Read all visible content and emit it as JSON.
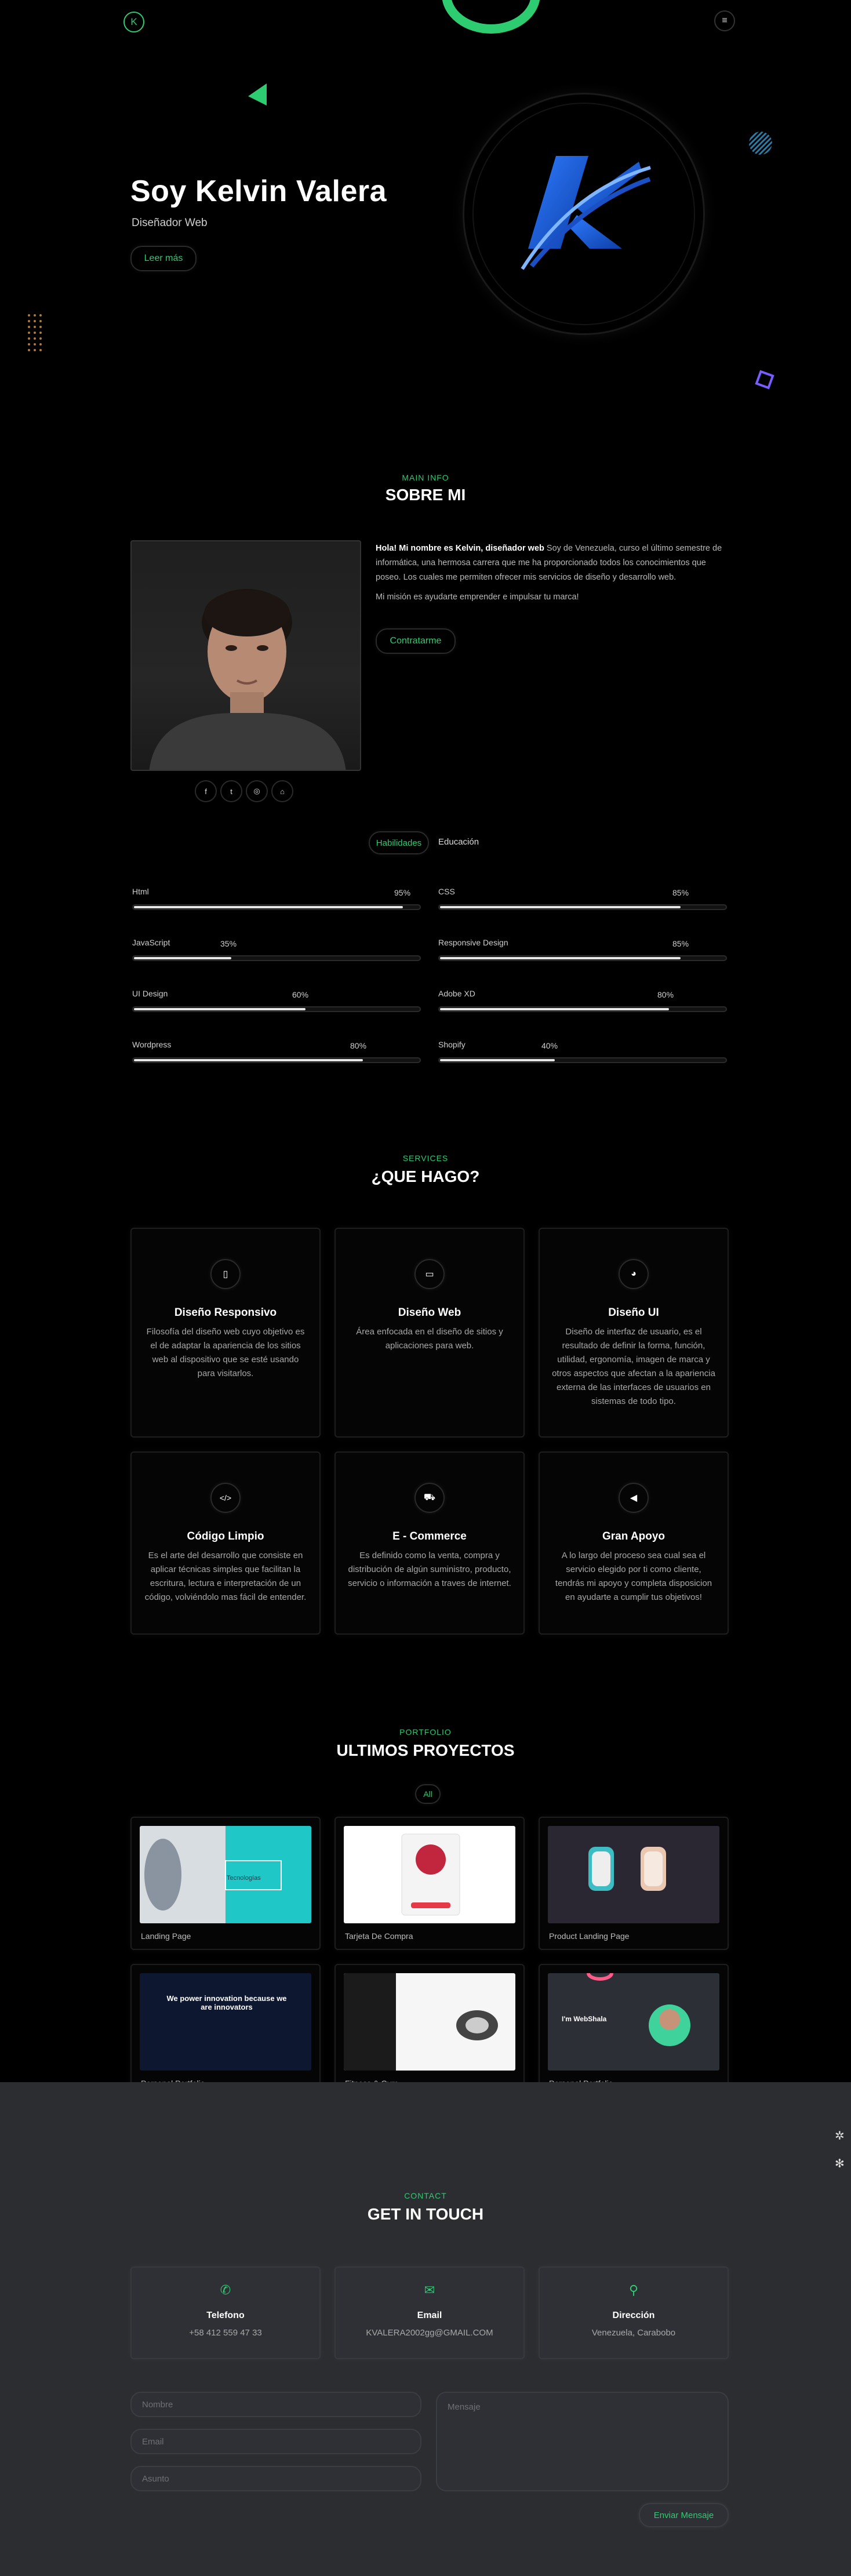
{
  "header": {
    "logo_letter": "K",
    "menu_icon": "menu-icon"
  },
  "hero": {
    "name": "Soy Kelvin Valera",
    "role": "Diseñador Web",
    "button": "Leer más"
  },
  "about": {
    "subtitle": "MAIN INFO",
    "title": "SOBRE MI",
    "intro_bold": "Hola! Mi nombre es Kelvin, diseñador web",
    "intro_rest": " Soy de Venezuela, curso el último semestre de informática, una hermosa carrera que me ha proporcionado todos los conocimientos que poseo. Los cuales me permiten ofrecer mis servicios de diseño y desarrollo web.",
    "mission": "Mi misión es ayudarte emprender e impulsar tu marca!",
    "button": "Contratarme",
    "socials": [
      "facebook-icon",
      "twitter-icon",
      "instagram-icon",
      "github-icon"
    ]
  },
  "tabs": {
    "skills": "Habilidades",
    "education": "Educación"
  },
  "skills": [
    {
      "name": "Html",
      "pct": "95%",
      "value": 0.95
    },
    {
      "name": "CSS",
      "pct": "85%",
      "value": 0.85
    },
    {
      "name": "JavaScript",
      "pct": "35%",
      "value": 0.35
    },
    {
      "name": "Responsive Design",
      "pct": "85%",
      "value": 0.85
    },
    {
      "name": "UI Design",
      "pct": "60%",
      "value": 0.6
    },
    {
      "name": "Adobe XD",
      "pct": "80%",
      "value": 0.8
    },
    {
      "name": "Wordpress",
      "pct": "80%",
      "value": 0.8
    },
    {
      "name": "Shopify",
      "pct": "40%",
      "value": 0.4
    }
  ],
  "services": {
    "subtitle": "SERVICES",
    "title": "¿QUE HAGO?",
    "items": [
      {
        "title": "Diseño Responsivo",
        "icon": "mobile-icon",
        "desc": "Filosofía del diseño web cuyo objetivo es el de adaptar la apariencia de los sitios web al dispositivo que se esté usando para visitarlos."
      },
      {
        "title": "Diseño Web",
        "icon": "laptop-icon",
        "desc": "Área enfocada en el diseño de sitios y aplicaciones para web."
      },
      {
        "title": "Diseño UI",
        "icon": "palette-icon",
        "desc": "Diseño de interfaz de usuario, es el resultado de definir la forma, función, utilidad, ergonomía, imagen de marca y otros aspectos que afectan a la apariencia externa de las interfaces de usuarios en sistemas de todo tipo."
      },
      {
        "title": "Código Limpio",
        "icon": "code-icon",
        "desc": "Es el arte del desarrollo que consiste en aplicar técnicas simples que facilitan la escritura, lectura e interpretación de un código, volviéndolo mas fácil de entender."
      },
      {
        "title": "E - Commerce",
        "icon": "cart-icon",
        "desc": "Es definido como la venta, compra y distribución de algún suministro, producto, servicio o información a traves de internet."
      },
      {
        "title": "Gran Apoyo",
        "icon": "megaphone-icon",
        "desc": "A lo largo del proceso sea cual sea el servicio elegido por ti como cliente, tendrás mi apoyo y completa disposicion en ayudarte a cumplir tus objetivos!"
      }
    ]
  },
  "portfolio": {
    "subtitle": "PORTFOLIO",
    "title": "ULTIMOS PROYECTOS",
    "filter": "All",
    "items": [
      {
        "caption": "Landing Page",
        "thumb_text": "Tecnologías"
      },
      {
        "caption": "Tarjeta De Compra",
        "thumb_text": ""
      },
      {
        "caption": "Product Landing Page",
        "thumb_text": ""
      },
      {
        "caption": "Personal Portfolio",
        "thumb_text": "We power innovation because we are innovators"
      },
      {
        "caption": "Fitness & Gym",
        "thumb_text": ""
      },
      {
        "caption": "Personal Portfolio",
        "thumb_text": "I'm WebShala"
      }
    ]
  },
  "contact": {
    "subtitle": "CONTACT",
    "title": "GET IN TOUCH",
    "items": [
      {
        "title": "Telefono",
        "value": "+58 412 559 47 33",
        "icon": "phone-icon"
      },
      {
        "title": "Email",
        "value": "KVALERA2002gg@GMAIL.COM",
        "icon": "envelope-icon"
      },
      {
        "title": "Dirección",
        "value": "Venezuela, Carabobo",
        "icon": "map-pin-icon"
      }
    ],
    "form": {
      "name": "Nombre",
      "email": "Email",
      "subject": "Asunto",
      "message": "Mensaje",
      "submit": "Enviar Mensaje"
    }
  },
  "colors": {
    "accent": "#2ecc71",
    "background": "#000000",
    "contact_bg": "#2b2d31",
    "logo_blue": "#1e5bd6"
  }
}
